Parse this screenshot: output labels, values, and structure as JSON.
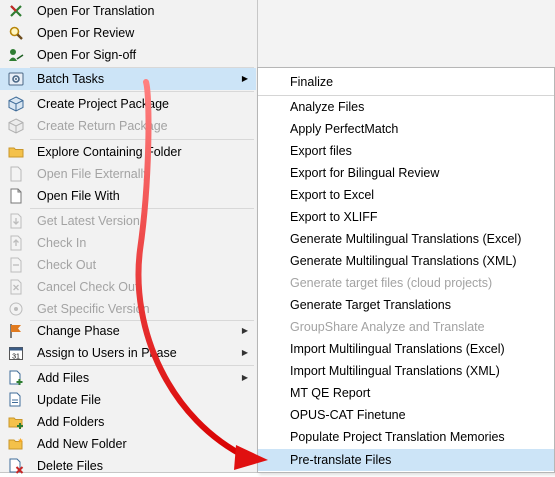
{
  "colors": {
    "highlight": "#cce4f7",
    "disabled_text": "#a3a3a3",
    "arrow": "#e01010",
    "menu_bg": "#f2f2f2"
  },
  "main_menu": {
    "items": [
      {
        "label": "Open For Translation",
        "icon": "open-translation-icon"
      },
      {
        "label": "Open For Review",
        "icon": "magnifier-icon"
      },
      {
        "label": "Open For Sign-off",
        "icon": "sign-off-icon"
      },
      {
        "label": "Batch Tasks",
        "icon": "batch-tasks-icon",
        "submenu": "▶"
      },
      {
        "label": "Create Project Package",
        "icon": "package-icon"
      },
      {
        "label": "Create Return Package",
        "icon": "return-package-icon"
      },
      {
        "label": "Explore Containing Folder",
        "icon": "folder-icon"
      },
      {
        "label": "Open File Externally",
        "icon": "file-external-icon"
      },
      {
        "label": "Open File With",
        "icon": "file-with-icon"
      },
      {
        "label": "Get Latest Version",
        "icon": "get-latest-icon"
      },
      {
        "label": "Check In",
        "icon": "check-in-icon"
      },
      {
        "label": "Check Out",
        "icon": "check-out-icon"
      },
      {
        "label": "Cancel Check Out",
        "icon": "cancel-checkout-icon"
      },
      {
        "label": "Get Specific Version",
        "icon": "specific-version-icon"
      },
      {
        "label": "Change Phase",
        "icon": "phase-flag-icon",
        "submenu": "▶"
      },
      {
        "label": "Assign to Users in Phase",
        "icon": "calendar-icon",
        "submenu": "▶"
      },
      {
        "label": "Add Files",
        "icon": "add-files-icon",
        "submenu": "▶"
      },
      {
        "label": "Update File",
        "icon": "update-file-icon"
      },
      {
        "label": "Add Folders",
        "icon": "add-folders-icon"
      },
      {
        "label": "Add New Folder",
        "icon": "new-folder-icon"
      },
      {
        "label": "Delete Files",
        "icon": "delete-files-icon"
      }
    ]
  },
  "batch_submenu": {
    "items": [
      {
        "label": "Finalize"
      },
      {
        "label": "Analyze Files"
      },
      {
        "label": "Apply PerfectMatch"
      },
      {
        "label": "Export files"
      },
      {
        "label": "Export for Bilingual Review"
      },
      {
        "label": "Export to Excel"
      },
      {
        "label": "Export to XLIFF"
      },
      {
        "label": "Generate Multilingual Translations (Excel)"
      },
      {
        "label": "Generate Multilingual Translations (XML)"
      },
      {
        "label": "Generate target files (cloud projects)"
      },
      {
        "label": "Generate Target Translations"
      },
      {
        "label": "GroupShare Analyze and Translate"
      },
      {
        "label": "Import Multilingual Translations (Excel)"
      },
      {
        "label": "Import Multilingual Translations (XML)"
      },
      {
        "label": "MT QE Report"
      },
      {
        "label": "OPUS-CAT Finetune"
      },
      {
        "label": "Populate Project Translation Memories"
      },
      {
        "label": "Pre-translate Files"
      }
    ]
  }
}
